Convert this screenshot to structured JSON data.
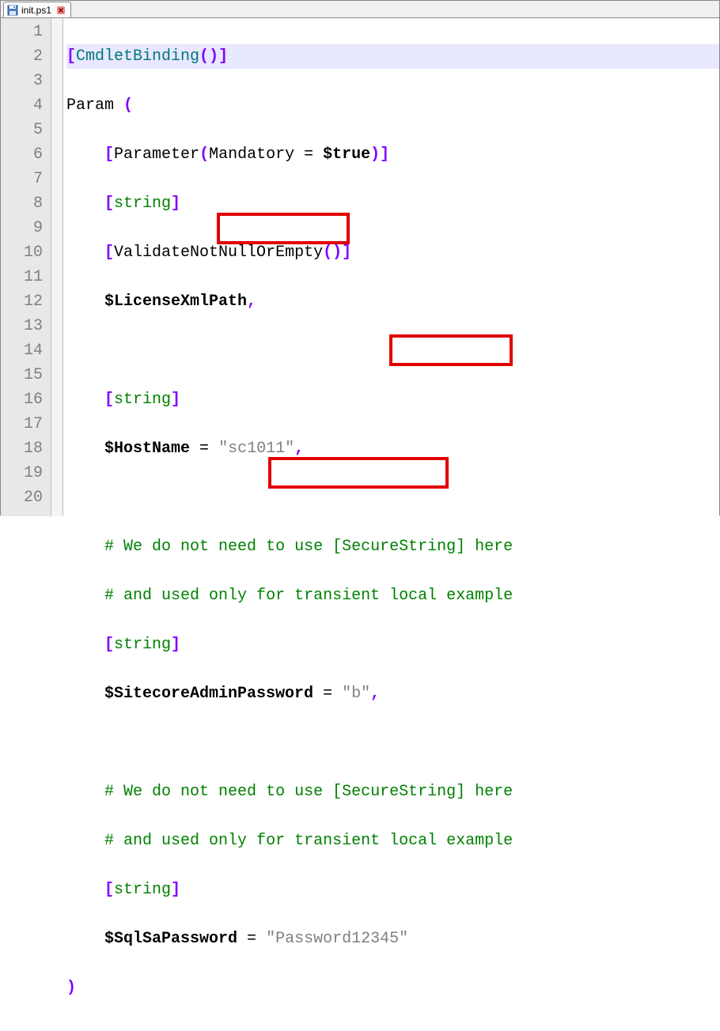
{
  "tab": {
    "filename": "init.ps1"
  },
  "gutter": [
    "1",
    "2",
    "3",
    "4",
    "5",
    "6",
    "7",
    "8",
    "9",
    "10",
    "11",
    "12",
    "13",
    "14",
    "15",
    "16",
    "17",
    "18",
    "19",
    "20"
  ],
  "line1": {
    "ob": "[",
    "cmd": "CmdletBinding",
    "op": "(",
    "cp": ")",
    "cb": "]"
  },
  "line2": {
    "paramkw": "Param",
    "op": " ("
  },
  "line3": {
    "indent": "    ",
    "ob": "[",
    "param": "Parameter",
    "op": "(",
    "mand": "Mandatory",
    "eq": " = ",
    "val": "$true",
    "cp": ")",
    "cb": "]"
  },
  "line4": {
    "indent": "    ",
    "ob": "[",
    "type": "string",
    "cb": "]"
  },
  "line5": {
    "indent": "    ",
    "ob": "[",
    "val": "ValidateNotNullOrEmpty",
    "op": "(",
    "cp": ")",
    "cb": "]"
  },
  "line6": {
    "indent": "    ",
    "var": "$LicenseXmlPath",
    "comma": ","
  },
  "line8": {
    "indent": "    ",
    "ob": "[",
    "type": "string",
    "cb": "]"
  },
  "line9": {
    "indent": "    ",
    "var": "$HostName",
    "eq": " = ",
    "str": "\"sc1011\"",
    "comma": ","
  },
  "line11": {
    "indent": "    ",
    "hash": "#",
    "txt": " We do not need to use [SecureString] here"
  },
  "line12": {
    "indent": "    ",
    "hash": "#",
    "txt": " and used only for transient local example"
  },
  "line13": {
    "indent": "    ",
    "ob": "[",
    "type": "string",
    "cb": "]"
  },
  "line14": {
    "indent": "    ",
    "var": "$SitecoreAdminPassword",
    "eq": " = ",
    "str": "\"b\"",
    "comma": ","
  },
  "line16": {
    "indent": "    ",
    "hash": "#",
    "txt": " We do not need to use [SecureString] here"
  },
  "line17": {
    "indent": "    ",
    "hash": "#",
    "txt": " and used only for transient local example"
  },
  "line18": {
    "indent": "    ",
    "ob": "[",
    "type": "string",
    "cb": "]"
  },
  "line19": {
    "indent": "    ",
    "var": "$SqlSaPassword",
    "eq": " = ",
    "str": "\"Password12345\""
  },
  "line20": {
    "cp": ")"
  }
}
